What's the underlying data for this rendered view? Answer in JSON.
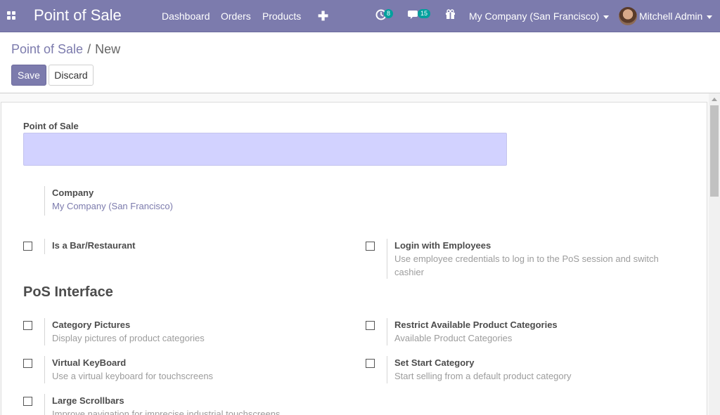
{
  "navbar": {
    "brand": "Point of Sale",
    "menu": [
      "Dashboard",
      "Orders",
      "Products"
    ],
    "activity_badge": "8",
    "message_badge": "15",
    "company": "My Company (San Francisco)",
    "user": "Mitchell Admin",
    "icons": [
      "apps-icon",
      "plus-icon",
      "activity-clock-icon",
      "chat-icon",
      "gift-icon",
      "chevron-down-icon"
    ]
  },
  "breadcrumb": {
    "parent": "Point of Sale",
    "separator": "/",
    "current": "New"
  },
  "buttons": {
    "save": "Save",
    "discard": "Discard"
  },
  "form": {
    "name_label": "Point of Sale",
    "name_value": "",
    "company_label": "Company",
    "company_value": "My Company (San Francisco)",
    "options": {
      "bar_restaurant": {
        "title": "Is a Bar/Restaurant",
        "checked": false
      },
      "login_employees": {
        "title": "Login with Employees",
        "desc": "Use employee credentials to log in to the PoS session and switch cashier",
        "checked": false
      }
    },
    "section_title": "PoS Interface",
    "interface": {
      "category_pictures": {
        "title": "Category Pictures",
        "desc": "Display pictures of product categories",
        "checked": false
      },
      "restrict_categories": {
        "title": "Restrict Available Product Categories",
        "desc": "Available Product Categories",
        "checked": false
      },
      "virtual_keyboard": {
        "title": "Virtual KeyBoard",
        "desc": "Use a virtual keyboard for touchscreens",
        "checked": false
      },
      "start_category": {
        "title": "Set Start Category",
        "desc": "Start selling from a default product category",
        "checked": false
      },
      "large_scrollbars": {
        "title": "Large Scrollbars",
        "desc": "Improve navigation for imprecise industrial touchscreens",
        "checked": false
      }
    }
  },
  "colors": {
    "primary": "#7c7bad",
    "input_highlight": "#d2d2ff",
    "badge": "#00a09d"
  }
}
